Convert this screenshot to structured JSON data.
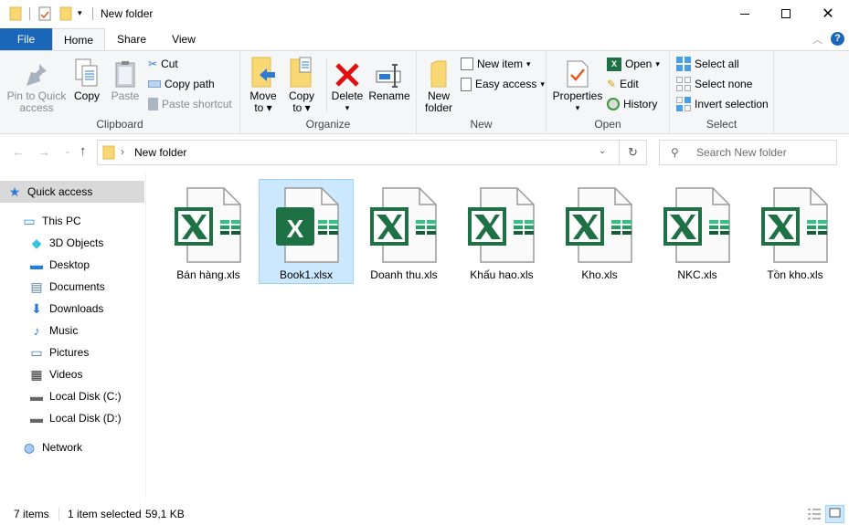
{
  "window": {
    "title": "New folder"
  },
  "ribbon_tabs": {
    "file": "File",
    "home": "Home",
    "share": "Share",
    "view": "View"
  },
  "clipboard": {
    "group": "Clipboard",
    "pin": "Pin to Quick access",
    "pin_l1": "Pin to Quick",
    "pin_l2": "access",
    "copy": "Copy",
    "paste": "Paste",
    "cut": "Cut",
    "copy_path": "Copy path",
    "paste_shortcut": "Paste shortcut"
  },
  "organize": {
    "group": "Organize",
    "move_l1": "Move",
    "move_l2": "to",
    "copy_l1": "Copy",
    "copy_l2": "to",
    "delete": "Delete",
    "rename": "Rename"
  },
  "new": {
    "group": "New",
    "folder_l1": "New",
    "folder_l2": "folder",
    "new_item": "New item",
    "easy_access": "Easy access"
  },
  "open": {
    "group": "Open",
    "properties": "Properties",
    "open": "Open",
    "edit": "Edit",
    "history": "History"
  },
  "select": {
    "group": "Select",
    "all": "Select all",
    "none": "Select none",
    "invert": "Invert selection"
  },
  "nav": {
    "path": "New folder",
    "search_placeholder": "Search New folder"
  },
  "sidebar": {
    "items": [
      {
        "label": "Quick access",
        "icon": "star-icon"
      },
      {
        "label": "This PC",
        "icon": "computer-icon"
      },
      {
        "label": "3D Objects",
        "icon": "cube-icon"
      },
      {
        "label": "Desktop",
        "icon": "desktop-icon"
      },
      {
        "label": "Documents",
        "icon": "document-icon"
      },
      {
        "label": "Downloads",
        "icon": "download-icon"
      },
      {
        "label": "Music",
        "icon": "music-icon"
      },
      {
        "label": "Pictures",
        "icon": "picture-icon"
      },
      {
        "label": "Videos",
        "icon": "video-icon"
      },
      {
        "label": "Local Disk (C:)",
        "icon": "drive-icon"
      },
      {
        "label": "Local Disk (D:)",
        "icon": "drive-icon"
      },
      {
        "label": "Network",
        "icon": "network-icon"
      }
    ]
  },
  "files": [
    {
      "name": "Bán hàng.xls",
      "selected": false,
      "type": "xls"
    },
    {
      "name": "Book1.xlsx",
      "selected": true,
      "type": "xlsx"
    },
    {
      "name": "Doanh thu.xls",
      "selected": false,
      "type": "xls"
    },
    {
      "name": "Khấu hao.xls",
      "selected": false,
      "type": "xls"
    },
    {
      "name": "Kho.xls",
      "selected": false,
      "type": "xls"
    },
    {
      "name": "NKC.xls",
      "selected": false,
      "type": "xls"
    },
    {
      "name": "Tồn kho.xls",
      "selected": false,
      "type": "xls"
    }
  ],
  "status": {
    "count": "7 items",
    "selection": "1 item selected",
    "size": "59,1 KB"
  },
  "colors": {
    "accent": "#1a66b8",
    "excel": "#1e7145",
    "selection": "#cce8ff"
  }
}
